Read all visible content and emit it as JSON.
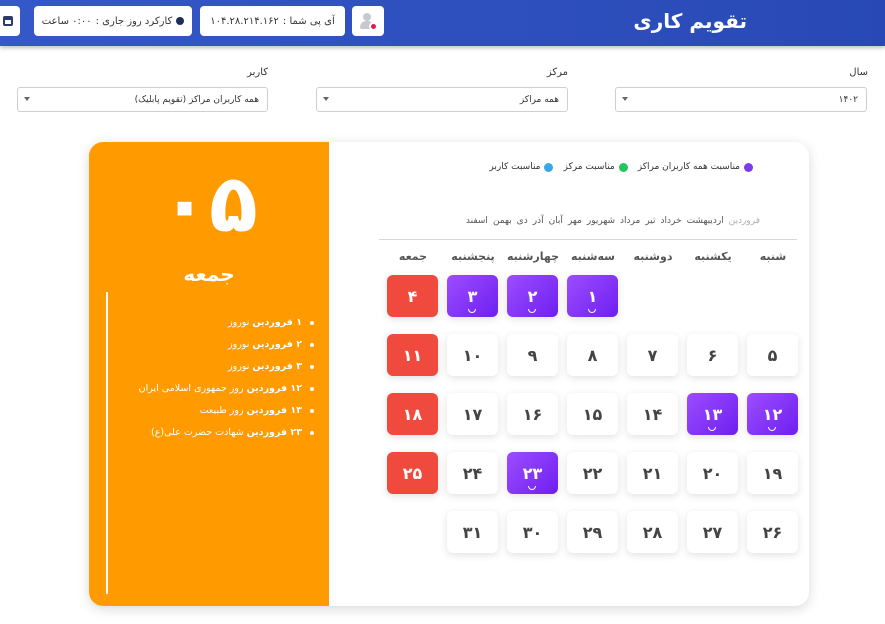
{
  "header": {
    "title": "تقویم کاری",
    "work_label": "کارکرد روز جاری :",
    "work_value": "۰:۰۰ ساعت",
    "ip_label": "آی پی شما :",
    "ip_value": "۱۰۴.۲۸.۲۱۴.۱۶۲"
  },
  "filters": {
    "year": {
      "label": "سال",
      "value": "۱۴۰۲"
    },
    "center": {
      "label": "مرکز",
      "value": "همه مراکز"
    },
    "user": {
      "label": "کاربر",
      "value": "همه کاربران مراکز (تقویم پابلیک)"
    }
  },
  "selected": {
    "day": "۰۵",
    "weekday": "جمعه",
    "events": [
      {
        "date": "۱ فروردین",
        "title": "نوروز"
      },
      {
        "date": "۲ فروردین",
        "title": "نوروز"
      },
      {
        "date": "۳ فروردین",
        "title": "نوروز"
      },
      {
        "date": "۱۲ فروردین",
        "title": "روز جمهوری اسلامی ایران"
      },
      {
        "date": "۱۳ فروردین",
        "title": "روز طبیعت"
      },
      {
        "date": "۲۳ فروردین",
        "title": "شهادت حضرت علی(ع)"
      }
    ]
  },
  "legend": [
    {
      "label": "مناسبت همه کاربران مراکز",
      "color": "#7c3aed"
    },
    {
      "label": "مناسبت مرکز",
      "color": "#22c55e"
    },
    {
      "label": "مناسبت کاربر",
      "color": "#38a6e8"
    }
  ],
  "months": [
    "فروردین",
    "اردیبهشت",
    "خرداد",
    "تیر",
    "مرداد",
    "شهریور",
    "مهر",
    "آبان",
    "آذر",
    "دی",
    "بهمن",
    "اسفند"
  ],
  "active_month": "فروردین",
  "weekdays": [
    "شنبه",
    "یکشنبه",
    "دوشنبه",
    "سه‌شنبه",
    "چهارشنبه",
    "پنجشنبه",
    "جمعه"
  ],
  "weeks": [
    [
      null,
      null,
      null,
      {
        "n": "۱",
        "t": "purple",
        "h": true
      },
      {
        "n": "۲",
        "t": "purple",
        "h": true
      },
      {
        "n": "۳",
        "t": "purple",
        "h": true
      },
      {
        "n": "۴",
        "t": "red"
      }
    ],
    [
      {
        "n": "۵"
      },
      {
        "n": "۶"
      },
      {
        "n": "۷"
      },
      {
        "n": "۸"
      },
      {
        "n": "۹"
      },
      {
        "n": "۱۰"
      },
      {
        "n": "۱۱",
        "t": "red"
      }
    ],
    [
      {
        "n": "۱۲",
        "t": "purple",
        "h": true
      },
      {
        "n": "۱۳",
        "t": "purple",
        "h": true
      },
      {
        "n": "۱۴"
      },
      {
        "n": "۱۵"
      },
      {
        "n": "۱۶"
      },
      {
        "n": "۱۷"
      },
      {
        "n": "۱۸",
        "t": "red"
      }
    ],
    [
      {
        "n": "۱۹"
      },
      {
        "n": "۲۰"
      },
      {
        "n": "۲۱"
      },
      {
        "n": "۲۲"
      },
      {
        "n": "۲۳",
        "t": "purple",
        "h": true
      },
      {
        "n": "۲۴"
      },
      {
        "n": "۲۵",
        "t": "red"
      }
    ],
    [
      {
        "n": "۲۶"
      },
      {
        "n": "۲۷"
      },
      {
        "n": "۲۸"
      },
      {
        "n": "۲۹"
      },
      {
        "n": "۳۰"
      },
      {
        "n": "۳۱"
      },
      null
    ]
  ]
}
